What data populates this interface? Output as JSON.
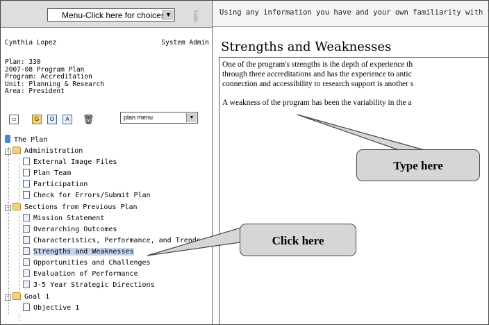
{
  "menu": {
    "select_label": "Menu-Click here for choices",
    "hide_label": "hide"
  },
  "user": {
    "name": "Cynthia Lopez",
    "role": "System Admin"
  },
  "plan_info": [
    "Plan: 330",
    "2007-08 Program Plan",
    "Program: Accreditation",
    "Unit: Planning & Research",
    "Area: President"
  ],
  "toolbar": {
    "icons": [
      "window-icon",
      "folder-g-icon",
      "folder-o-icon",
      "folder-a-icon",
      "trash-icon"
    ],
    "plan_menu_label": "plan menu"
  },
  "tree": {
    "root": "The Plan",
    "administration": {
      "label": "Administration",
      "items": [
        "External Image Files",
        "Plan Team",
        "Participation",
        "Check for Errors/Submit Plan"
      ]
    },
    "sections": {
      "label": "Sections from Previous Plan",
      "items": [
        "Mission Statement",
        "Overarching Outcomes",
        "Characteristics, Performance, and Trends",
        "Strengths and Weaknesses",
        "Opportunities and Challenges",
        "Evaluation of Performance",
        "3-5 Year Strategic Directions"
      ],
      "selected": "Strengths and Weaknesses"
    },
    "goal": {
      "label": "Goal 1",
      "items": [
        "Objective 1"
      ]
    }
  },
  "content": {
    "instruction": "Using any information you have and your own familiarity with th",
    "title": "Strengths and Weaknesses",
    "paragraph1": [
      "One of the program's strengths is the depth of experience th",
      "through three accreditations and has the experience to antic",
      "connection and accessibility to research support is another s"
    ],
    "paragraph2": "A weakness of the program has been the variability in the a"
  },
  "callouts": {
    "type_here": "Type here",
    "click_here": "Click here"
  }
}
